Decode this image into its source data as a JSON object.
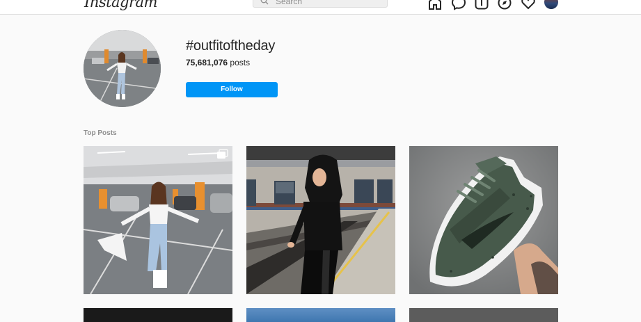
{
  "nav": {
    "logo": "Instagram",
    "search_placeholder": "Search",
    "icons": [
      "home-icon",
      "messenger-icon",
      "new-post-icon",
      "explore-icon",
      "activity-heart-icon"
    ]
  },
  "hashtag": {
    "title": "#outfitoftheday",
    "post_count": "75,681,076",
    "post_count_suffix": " posts",
    "follow_label": "Follow"
  },
  "section": {
    "top_posts_label": "Top Posts"
  },
  "posts": [
    {
      "name": "post-parking-garage",
      "has_multi_icon": true
    },
    {
      "name": "post-train-station"
    },
    {
      "name": "post-green-sneaker"
    }
  ],
  "colors": {
    "accent": "#0095f6",
    "background": "#fafafa",
    "text": "#262626",
    "muted": "#8e8e8e"
  }
}
